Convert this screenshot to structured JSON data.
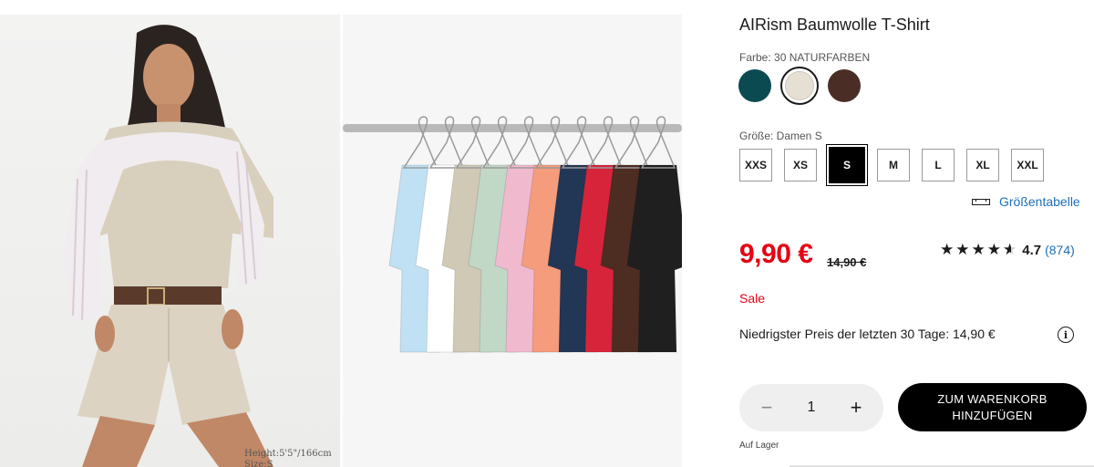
{
  "product": {
    "title": "AIRism Baumwolle T-Shirt",
    "color_label": "Farbe: 30 NATURFARBEN",
    "colors": [
      "#0c4a52",
      "#e5e0d3",
      "#4a2e25"
    ],
    "selected_color_index": 1,
    "size_label": "Größe: Damen S",
    "sizes": [
      "XXS",
      "XS",
      "S",
      "M",
      "L",
      "XL",
      "XXL"
    ],
    "selected_size": "S",
    "size_chart_label": "Größentabelle",
    "price": "9,90 €",
    "old_price": "14,90 €",
    "rating": {
      "value": "4.7",
      "count": "(874)",
      "stars": 4.5
    },
    "sale_label": "Sale",
    "lowest_price_text": "Niedrigster Preis der letzten 30 Tage: 14,90 €",
    "quantity": "1",
    "add_to_cart_line1": "ZUM WARENKORB",
    "add_to_cart_line2": "HINZUFÜGEN",
    "stock_label": "Auf Lager"
  },
  "photo": {
    "caption_line1": "Height:5'5\"/166cm",
    "caption_line2": "Size:S"
  },
  "rack_colors": [
    "#bfe1f3",
    "#ffffff",
    "#cfc9b6",
    "#c2d8c6",
    "#f1b9ce",
    "#f49c7c",
    "#223656",
    "#d8243a",
    "#4d2c22",
    "#1f1f1f"
  ],
  "accent": {
    "sale_red": "#e60012",
    "link_blue": "#1d6fb8"
  }
}
